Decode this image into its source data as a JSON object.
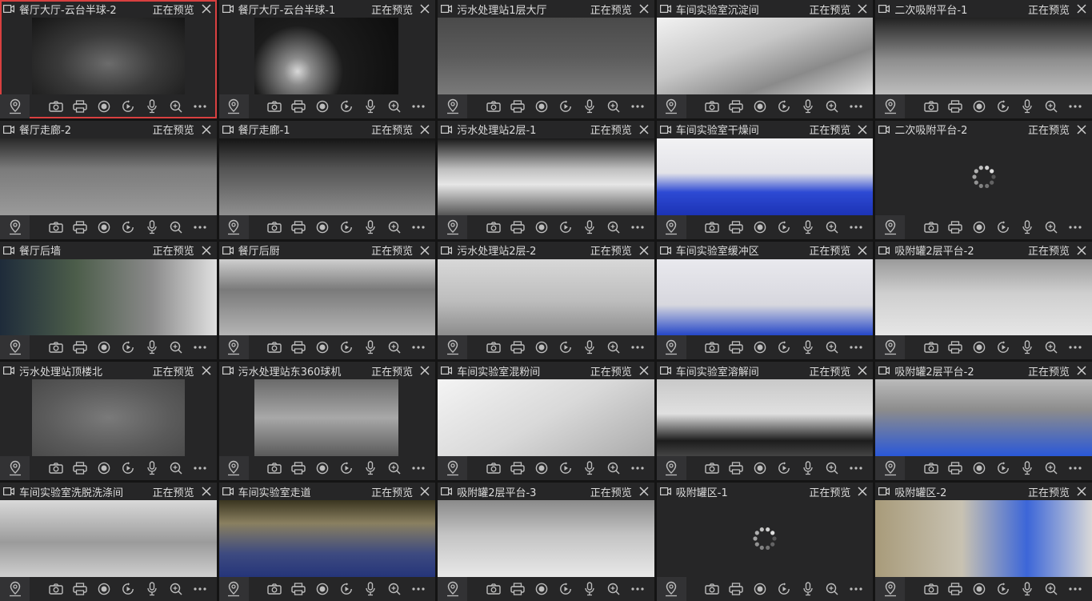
{
  "status_label": "正在预览",
  "colors": {
    "selected_border": "#d94040",
    "cell_bg": "#262627",
    "text": "#dcdcdc"
  },
  "toolbar_icons": [
    "location-icon",
    "snapshot-icon",
    "print-icon",
    "record-icon",
    "playback-icon",
    "microphone-icon",
    "zoom-icon",
    "more-icon"
  ],
  "cells": [
    {
      "title": "餐厅大厅-云台半球-2",
      "selected": true,
      "loading": false,
      "scene": "dark-hall"
    },
    {
      "title": "餐厅大厅-云台半球-1",
      "selected": false,
      "loading": false,
      "scene": "dark-lamp"
    },
    {
      "title": "污水处理站1层大厅",
      "selected": false,
      "loading": false,
      "scene": "gray-hall"
    },
    {
      "title": "车间实验室沉淀间",
      "selected": false,
      "loading": false,
      "scene": "steel-stairs"
    },
    {
      "title": "二次吸附平台-1",
      "selected": false,
      "loading": false,
      "scene": "tanks-dark"
    },
    {
      "title": "餐厅走廊-2",
      "selected": false,
      "loading": false,
      "scene": "night-yard"
    },
    {
      "title": "餐厅走廊-1",
      "selected": false,
      "loading": false,
      "scene": "night-yard2"
    },
    {
      "title": "污水处理站2层-1",
      "selected": false,
      "loading": false,
      "scene": "tank-room"
    },
    {
      "title": "车间实验室干燥间",
      "selected": false,
      "loading": false,
      "scene": "blue-room"
    },
    {
      "title": "二次吸附平台-2",
      "selected": false,
      "loading": true,
      "scene": "none"
    },
    {
      "title": "餐厅后墙",
      "selected": false,
      "loading": false,
      "scene": "wall-tree"
    },
    {
      "title": "餐厅后厨",
      "selected": false,
      "loading": false,
      "scene": "kitchen"
    },
    {
      "title": "污水处理站2层-2",
      "selected": false,
      "loading": false,
      "scene": "concrete"
    },
    {
      "title": "车间实验室缓冲区",
      "selected": false,
      "loading": false,
      "scene": "corridor-blue"
    },
    {
      "title": "吸附罐2层平台-2",
      "selected": false,
      "loading": false,
      "scene": "tanks-light"
    },
    {
      "title": "污水处理站顶楼北",
      "selected": false,
      "loading": false,
      "scene": "blur"
    },
    {
      "title": "污水处理站东360球机",
      "selected": false,
      "loading": false,
      "scene": "roof-grid"
    },
    {
      "title": "车间实验室混粉间",
      "selected": false,
      "loading": false,
      "scene": "mixer"
    },
    {
      "title": "车间实验室溶解间",
      "selected": false,
      "loading": false,
      "scene": "platform"
    },
    {
      "title": "吸附罐2层平台-2",
      "selected": false,
      "loading": false,
      "scene": "tanks-blue"
    },
    {
      "title": "车间实验室洗脱洗涤间",
      "selected": false,
      "loading": false,
      "scene": "wash-room"
    },
    {
      "title": "车间实验室走道",
      "selected": false,
      "loading": false,
      "scene": "hallway"
    },
    {
      "title": "吸附罐2层平台-3",
      "selected": false,
      "loading": false,
      "scene": "tanks-floor"
    },
    {
      "title": "吸附罐区-1",
      "selected": false,
      "loading": true,
      "scene": "none"
    },
    {
      "title": "吸附罐区-2",
      "selected": false,
      "loading": false,
      "scene": "tank-area"
    }
  ]
}
